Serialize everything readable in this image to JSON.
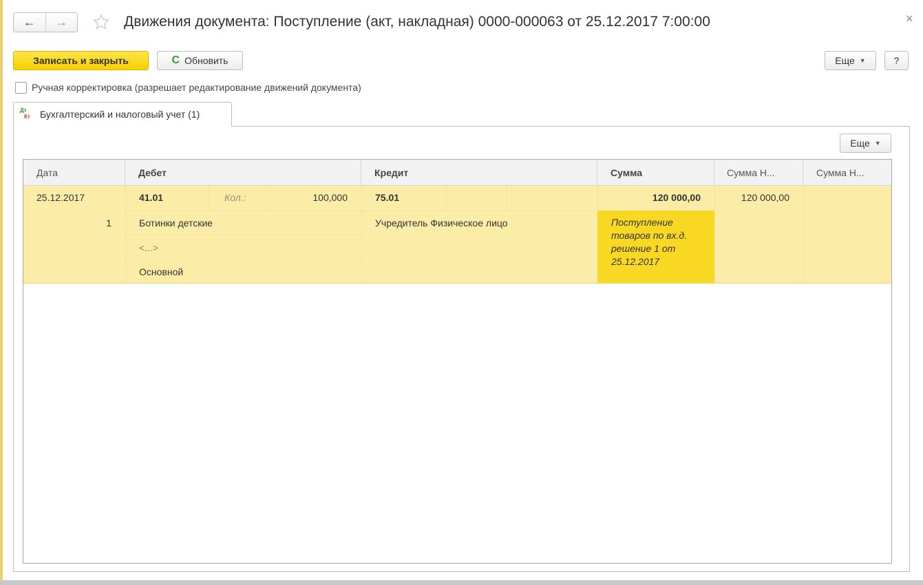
{
  "window": {
    "title": "Движения документа: Поступление (акт, накладная) 0000-000063 от 25.12.2017 7:00:00",
    "back_glyph": "←",
    "forward_glyph": "→",
    "close_glyph": "×"
  },
  "toolbar": {
    "save_close_label": "Записать и закрыть",
    "refresh_label": "Обновить",
    "refresh_glyph": "C",
    "more_label": "Еще",
    "help_label": "?"
  },
  "manual_correction": {
    "label": "Ручная корректировка (разрешает редактирование движений документа)",
    "checked": false
  },
  "tabs": [
    {
      "label": "Бухгалтерский и налоговый учет (1)",
      "icon": "dt-kt-icon",
      "icon_top": "Дт",
      "icon_bottom": "Кт"
    }
  ],
  "table": {
    "more_label": "Еще",
    "columns": [
      "Дата",
      "Дебет",
      "Кредит",
      "Сумма",
      "Сумма Н...",
      "Сумма Н..."
    ],
    "row": {
      "date": "25.12.2017",
      "number": "1",
      "debit_account": "41.01",
      "qty_label": "Кол.:",
      "qty_value": "100,000",
      "debit_subconto1": "Ботинки детские",
      "debit_subconto2": "<...>",
      "debit_subconto3": "Основной",
      "credit_account": "75.01",
      "credit_subconto1": "Учредитель Физическое лицо",
      "sum": "120 000,00",
      "sum_nu": "120 000,00",
      "content": "Поступление товаров по вх.д. решение 1 от 25.12.2017",
      "content_lines": [
        "Поступление",
        "товаров по вх.д.",
        "решение 1 от",
        "25.12.2017"
      ]
    }
  },
  "colors": {
    "primary_button": "#f5d000",
    "row_highlight": "#fbeca8",
    "selected_cell": "#f9d824",
    "refresh_icon": "#3a9b3a"
  }
}
